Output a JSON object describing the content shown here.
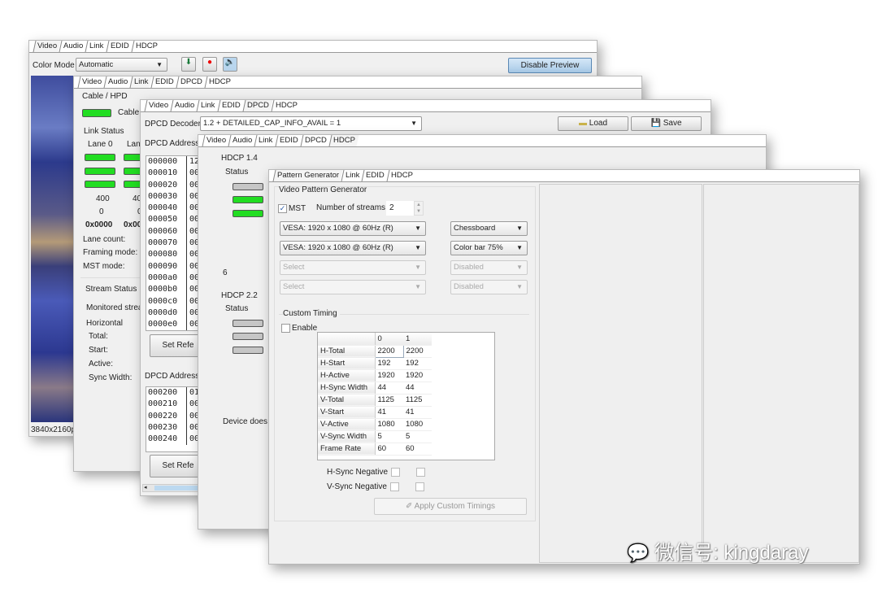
{
  "win1": {
    "tabs": [
      "Video",
      "Audio",
      "Link",
      "EDID",
      "HDCP"
    ],
    "color_mode_label": "Color Mode",
    "color_mode_value": "Automatic",
    "disable_preview": "Disable Preview",
    "resolution": "3840x2160p"
  },
  "win2": {
    "tabs": [
      "Video",
      "Audio",
      "Link",
      "EDID",
      "DPCD",
      "HDCP"
    ],
    "cable_hpd": "Cable / HPD",
    "cable": "Cable",
    "link_status": "Link Status",
    "lane0": "Lane 0",
    "lane1": "Lane",
    "rate": "400",
    "rate1": "40",
    "zero": "0",
    "zero1": "0",
    "hex0": "0x0000",
    "hex1": "0x00",
    "lane_count": "Lane count:",
    "framing_mode": "Framing mode:",
    "mst_mode": "MST mode:",
    "stream_status": "Stream Status",
    "monitored": "Monitored strea",
    "horizontal": "Horizontal",
    "total": "Total:",
    "start": "Start:",
    "active": "Active:",
    "sync_width": "Sync Width:"
  },
  "win3": {
    "tabs": [
      "Video",
      "Audio",
      "Link",
      "EDID",
      "DPCD",
      "HDCP"
    ],
    "decoder_label": "DPCD Decoder",
    "decoder_value": "1.2 + DETAILED_CAP_INFO_AVAIL = 1",
    "load": "Load",
    "save": "Save",
    "addr_label1": "DPCD Address r",
    "addr_label2": "DPCD Address r",
    "set_ref": "Set Refe",
    "hex1": [
      [
        "000000",
        "12"
      ],
      [
        "000010",
        "00"
      ],
      [
        "000020",
        "00"
      ],
      [
        "000030",
        "00"
      ],
      [
        "000040",
        "00"
      ],
      [
        "000050",
        "00"
      ],
      [
        "000060",
        "00"
      ],
      [
        "000070",
        "00"
      ],
      [
        "000080",
        "00"
      ],
      [
        "000090",
        "00"
      ],
      [
        "0000a0",
        "00"
      ],
      [
        "0000b0",
        "00"
      ],
      [
        "0000c0",
        "00"
      ],
      [
        "0000d0",
        "00"
      ],
      [
        "0000e0",
        "00"
      ]
    ],
    "hex2": [
      [
        "000200",
        "01"
      ],
      [
        "000210",
        "00"
      ],
      [
        "000220",
        "00"
      ],
      [
        "000230",
        "00"
      ],
      [
        "000240",
        "00"
      ]
    ]
  },
  "win4": {
    "tabs": [
      "Video",
      "Audio",
      "Link",
      "EDID",
      "DPCD",
      "HDCP"
    ],
    "hdcp14": "HDCP 1.4",
    "status": "Status",
    "six": "6",
    "hdcp22": "HDCP 2.2",
    "status2": "Status",
    "device": "Device does r",
    "leds14": [
      "off",
      "on",
      "on"
    ],
    "leds22": [
      "off",
      "off",
      "off"
    ]
  },
  "win5": {
    "tabs": [
      "Pattern Generator",
      "Link",
      "EDID",
      "HDCP"
    ],
    "vpg": "Video Pattern Generator",
    "mst": "MST",
    "mst_checked": true,
    "num_streams_label": "Number of streams",
    "num_streams": "2",
    "timings": [
      "VESA: 1920 x 1080 @ 60Hz (R)",
      "VESA: 1920 x 1080 @ 60Hz (R)",
      "Select",
      "Select"
    ],
    "patterns": [
      "Chessboard",
      "Color bar 75%",
      "Disabled",
      "Disabled"
    ],
    "custom_timing": "Custom Timing",
    "enable": "Enable",
    "table_header": [
      "",
      "0",
      "1"
    ],
    "table_rows": [
      [
        "H-Total",
        "2200",
        "2200"
      ],
      [
        "H-Start",
        "192",
        "192"
      ],
      [
        "H-Active",
        "1920",
        "1920"
      ],
      [
        "H-Sync Width",
        "44",
        "44"
      ],
      [
        "V-Total",
        "1125",
        "1125"
      ],
      [
        "V-Start",
        "41",
        "41"
      ],
      [
        "V-Active",
        "1080",
        "1080"
      ],
      [
        "V-Sync Width",
        "5",
        "5"
      ],
      [
        "Frame Rate",
        "60",
        "60"
      ]
    ],
    "hsync_neg": "H-Sync Negative",
    "vsync_neg": "V-Sync Negative",
    "apply": "Apply Custom Timings"
  },
  "watermark": "微信号: kingdaray",
  "colors": {
    "led_on": "#22dd22",
    "led_off": "#c6c6c6",
    "preview_button": "#b9d6ee"
  }
}
